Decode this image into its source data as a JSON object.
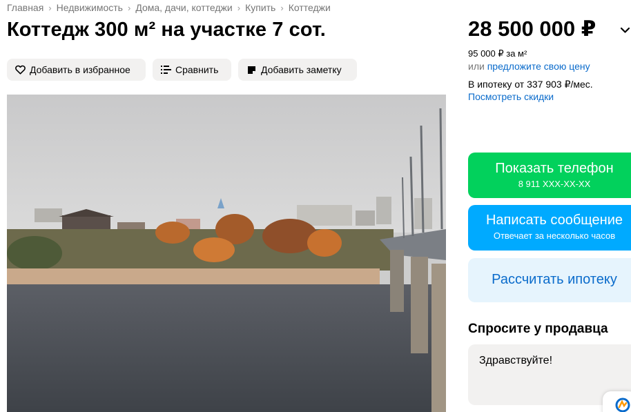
{
  "breadcrumbs": [
    "Главная",
    "Недвижимость",
    "Дома, дачи, коттеджи",
    "Купить",
    "Коттеджи"
  ],
  "title": "Коттедж 300 м² на участке 7 сот.",
  "actions": {
    "favorite": "Добавить в избранное",
    "compare": "Сравнить",
    "note": "Добавить заметку"
  },
  "price": {
    "value": "28 500 000 ₽",
    "per_m2": "95 000 ₽ за м²",
    "or_text": "или",
    "offer_link": "предложите свою цену",
    "mortgage": "В ипотеку от 337 903 ₽/мес.",
    "discounts_link": "Посмотреть скидки"
  },
  "buttons": {
    "phone_label": "Показать телефон",
    "phone_number": "8 911 XXX-XX-XX",
    "message_label": "Написать сообщение",
    "message_sub": "Отвечает за несколько часов",
    "mortgage_label": "Рассчитать ипотеку"
  },
  "ask_seller": {
    "title": "Спросите у продавца",
    "message": "Здравствуйте!"
  },
  "colors": {
    "green": "#02d15c",
    "blue": "#00aaff",
    "link": "#0a6bcb",
    "light_blue": "#e6f4fd",
    "gray_bg": "#f2f1f0"
  },
  "icons": [
    "heart-icon",
    "compare-icon",
    "note-icon",
    "chevron-down-icon",
    "chat-icon"
  ]
}
